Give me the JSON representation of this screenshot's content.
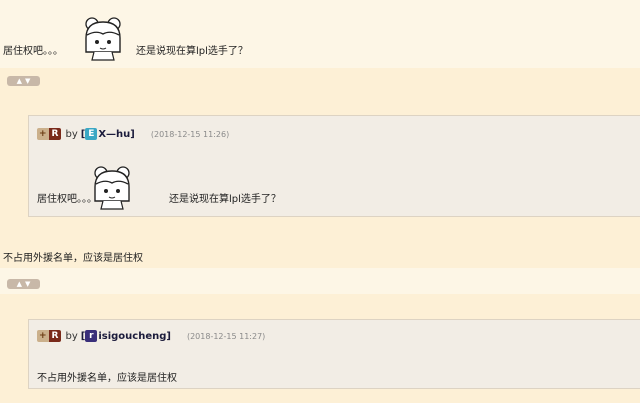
{
  "post1": {
    "text_before": "居住权吧。。。",
    "text_after": "还是说现在算lpl选手了？"
  },
  "quote1": {
    "plus": "+",
    "r": "R",
    "by": "by",
    "bracket_open": "[",
    "badge_letter": "E",
    "badge_color": "#3aa7c4",
    "username": "X—hu",
    "bracket_close": "]",
    "date": "(2018-12-15 11:26)",
    "text_before": "居住权吧。。。",
    "text_after": "还是说现在算lpl选手了？"
  },
  "post2": {
    "text": "不占用外援名单，应该是居住权"
  },
  "quote2": {
    "plus": "+",
    "r": "R",
    "by": "by",
    "bracket_open": "[",
    "badge_letter": "r",
    "badge_color": "#3a2f7a",
    "username": "isigoucheng",
    "bracket_close": "]",
    "date": "(2018-12-15 11:27)",
    "text": "不占用外援名单，应该是居住权"
  },
  "icons": {
    "vote_up": "thumbs-up-icon",
    "vote_down": "thumbs-down-icon",
    "sticker": "girl-sticker-icon"
  }
}
